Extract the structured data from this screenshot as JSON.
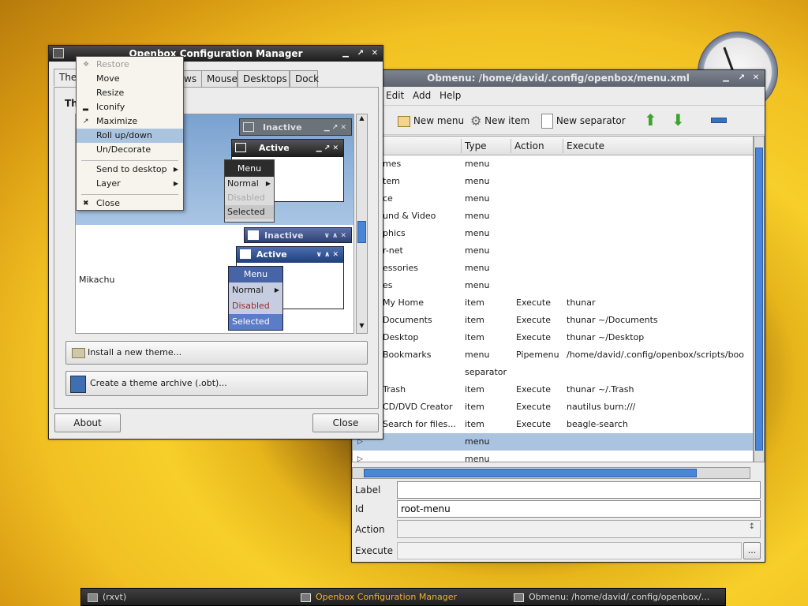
{
  "ocm": {
    "title": "Openbox Configuration Manager",
    "tabs": [
      "The",
      "ws",
      "Mouse",
      "Desktops",
      "Dock"
    ],
    "section": "Th",
    "preview": {
      "inactive": "Inactive",
      "active": "Active",
      "menu": "Menu",
      "normal": "Normal",
      "disabled": "Disabled",
      "selected": "Selected"
    },
    "theme2": "Mikachu",
    "install": "Install a new theme...",
    "archive": "Create a theme archive (.obt)...",
    "about": "About",
    "close": "Close"
  },
  "ctxmenu": [
    {
      "label": "Restore",
      "disabled": true
    },
    {
      "label": "Move"
    },
    {
      "label": "Resize"
    },
    {
      "label": "Iconify"
    },
    {
      "label": "Maximize"
    },
    {
      "label": "Roll up/down"
    },
    {
      "label": "Un/Decorate"
    },
    {
      "label": "Send to desktop"
    },
    {
      "label": "Layer"
    },
    {
      "label": "Close"
    }
  ],
  "obmenu": {
    "title": "Obmenu: /home/david/.config/openbox/menu.xml",
    "menubar": [
      "Edit",
      "Add",
      "Help"
    ],
    "toolbar": {
      "new_menu": "New menu",
      "new_item": "New item",
      "new_sep": "New separator"
    },
    "columns": [
      "Type",
      "Action",
      "Execute"
    ],
    "rows": [
      {
        "label": "mes",
        "type": "menu",
        "action": "",
        "exec": ""
      },
      {
        "label": "tem",
        "type": "menu",
        "action": "",
        "exec": ""
      },
      {
        "label": "ce",
        "type": "menu",
        "action": "",
        "exec": ""
      },
      {
        "label": "und & Video",
        "type": "menu",
        "action": "",
        "exec": ""
      },
      {
        "label": "phics",
        "type": "menu",
        "action": "",
        "exec": ""
      },
      {
        "label": "r-net",
        "type": "menu",
        "action": "",
        "exec": ""
      },
      {
        "label": "essories",
        "type": "menu",
        "action": "",
        "exec": ""
      },
      {
        "label": "es",
        "type": "menu",
        "action": "",
        "exec": ""
      },
      {
        "label": "My Home",
        "type": "item",
        "action": "Execute",
        "exec": "thunar"
      },
      {
        "label": "Documents",
        "type": "item",
        "action": "Execute",
        "exec": "thunar ~/Documents"
      },
      {
        "label": "Desktop",
        "type": "item",
        "action": "Execute",
        "exec": "thunar ~/Desktop"
      },
      {
        "label": "Bookmarks",
        "type": "menu",
        "action": "Pipemenu",
        "exec": "/home/david/.config/openbox/scripts/boo"
      },
      {
        "label": "",
        "type": "separator",
        "action": "",
        "exec": ""
      },
      {
        "label": "Trash",
        "type": "item",
        "action": "Execute",
        "exec": "thunar ~/.Trash"
      },
      {
        "label": "CD/DVD Creator",
        "type": "item",
        "action": "Execute",
        "exec": "nautilus burn:///"
      },
      {
        "label": "Search for files...",
        "type": "item",
        "action": "Execute",
        "exec": "beagle-search"
      },
      {
        "label": "",
        "type": "menu",
        "action": "",
        "exec": "",
        "selected": true
      },
      {
        "label": "",
        "type": "menu",
        "action": "",
        "exec": ""
      }
    ],
    "fields": {
      "label": "Label",
      "label_value": "",
      "id": "Id",
      "id_value": "root-menu",
      "action": "Action",
      "action_value": "",
      "execute": "Execute",
      "execute_value": ""
    },
    "browse": "..."
  },
  "taskbar": [
    "(rxvt)",
    "Openbox Configuration Manager",
    "Obmenu: /home/david/.config/openbox/..."
  ]
}
